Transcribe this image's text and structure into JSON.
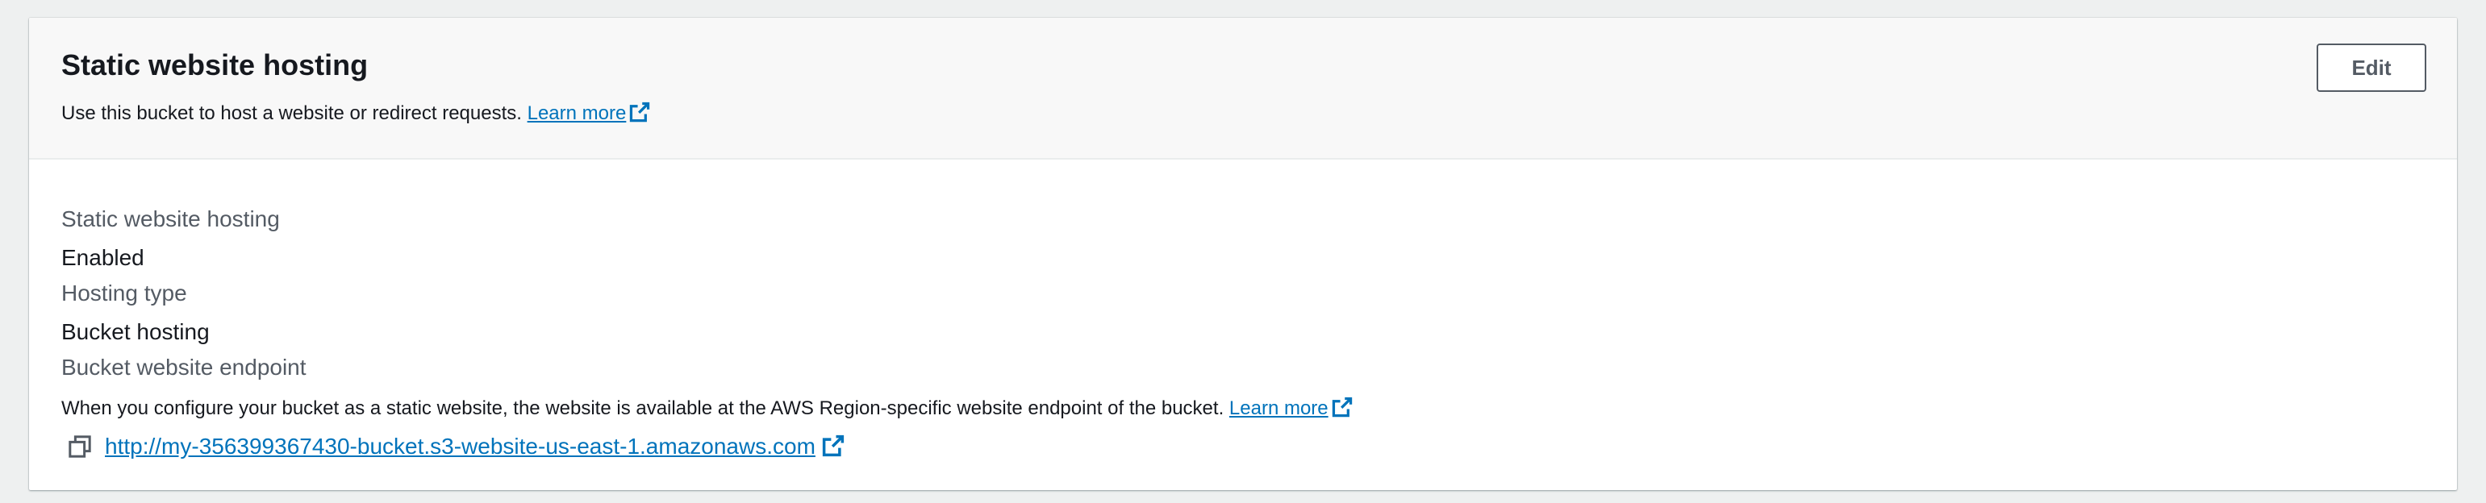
{
  "header": {
    "title": "Static website hosting",
    "subtitle": "Use this bucket to host a website or redirect requests.",
    "learn_more": "Learn more",
    "edit_label": "Edit"
  },
  "fields": {
    "hosting_label": "Static website hosting",
    "hosting_value": "Enabled",
    "type_label": "Hosting type",
    "type_value": "Bucket hosting",
    "endpoint_label": "Bucket website endpoint",
    "endpoint_desc": "When you configure your bucket as a static website, the website is available at the AWS Region-specific website endpoint of the bucket.",
    "endpoint_learn_more": "Learn more",
    "endpoint_url": "http://my-356399367430-bucket.s3-website-us-east-1.amazonaws.com"
  },
  "icons": {
    "external": "external-link-icon",
    "copy": "copy-icon"
  },
  "colors": {
    "link": "#0073bb",
    "text": "#16191f",
    "label": "#545b64",
    "header_bg": "#f8f8f8"
  }
}
